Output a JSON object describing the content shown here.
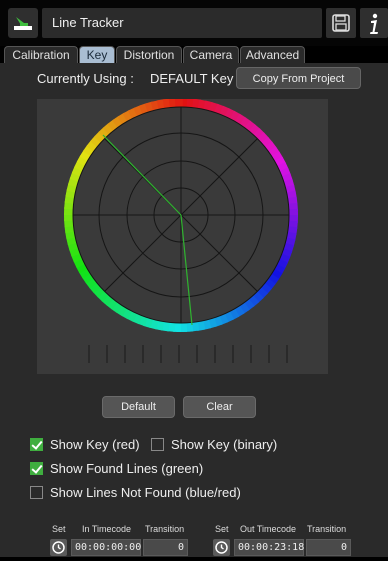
{
  "app": {
    "title": "Line Tracker"
  },
  "tabs": [
    {
      "label": "Calibration"
    },
    {
      "label": "Key",
      "active": true
    },
    {
      "label": "Distortion"
    },
    {
      "label": "Camera"
    },
    {
      "label": "Advanced"
    }
  ],
  "key": {
    "using_label": "Currently Using :",
    "using_value": "DEFAULT Key",
    "copy_button": "Copy From Project"
  },
  "buttons": {
    "default": "Default",
    "clear": "Clear"
  },
  "options": {
    "show_key_red": {
      "label": "Show Key (red)",
      "checked": true
    },
    "show_key_binary": {
      "label": "Show Key (binary)",
      "checked": false
    },
    "show_found_lines": {
      "label": "Show Found Lines (green)",
      "checked": true
    },
    "show_lines_not_found": {
      "label": "Show Lines Not Found (blue/red)",
      "checked": false
    }
  },
  "timecode": {
    "in": {
      "set_label": "Set",
      "label": "In Timecode",
      "value": "00:00:00:00",
      "transition_label": "Transition",
      "transition": "0"
    },
    "out": {
      "set_label": "Set",
      "label": "Out Timecode",
      "value": "00:00:23:18",
      "transition_label": "Transition",
      "transition": "0"
    }
  },
  "icons": {
    "logo": "line-tracker-logo-icon",
    "save": "floppy-disk-icon",
    "info": "info-icon",
    "clock": "clock-icon"
  }
}
